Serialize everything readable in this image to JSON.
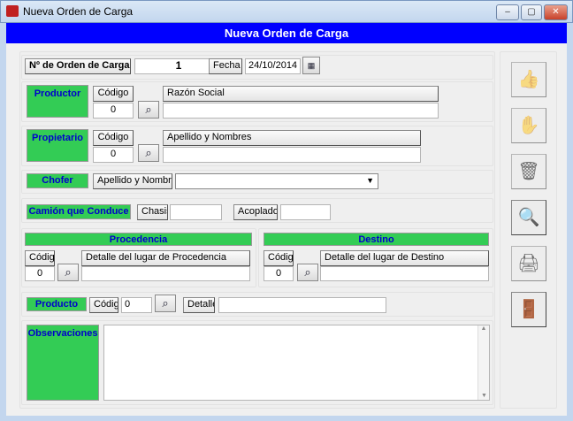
{
  "window": {
    "title": "Nueva Orden de Carga",
    "minimize": "‒",
    "maximize": "▢",
    "close": "✕"
  },
  "header": "Nueva Orden de Carga",
  "orden": {
    "label": "Nº de Orden de Carga",
    "value": "1",
    "fecha_label": "Fecha",
    "fecha_value": "24/10/2014"
  },
  "productor": {
    "label": "Productor",
    "codigo_label": "Código",
    "codigo_value": "0",
    "razon_label": "Razón Social",
    "razon_value": ""
  },
  "propietario": {
    "label": "Propietario",
    "codigo_label": "Código",
    "codigo_value": "0",
    "nombre_label": "Apellido y Nombres",
    "nombre_value": ""
  },
  "chofer": {
    "label": "Chofer",
    "nombre_label": "Apellido y Nombres",
    "select_value": ""
  },
  "camion": {
    "label": "Camión que Conduce",
    "chasis_label": "Chasis",
    "chasis_value": "",
    "acoplado_label": "Acoplado",
    "acoplado_value": ""
  },
  "procedencia": {
    "label": "Procedencia",
    "codigo_label": "Código",
    "codigo_value": "0",
    "detalle_label": "Detalle del lugar de Procedencia",
    "detalle_value": ""
  },
  "destino": {
    "label": "Destino",
    "codigo_label": "Código",
    "codigo_value": "0",
    "detalle_label": "Detalle del lugar de Destino",
    "detalle_value": ""
  },
  "producto": {
    "label": "Producto",
    "codigo_label": "Código",
    "codigo_value": "0",
    "detalle_label": "Detalle",
    "detalle_value": ""
  },
  "observaciones": {
    "label": "Observaciones",
    "value": ""
  },
  "toolbar": [
    {
      "icon": "accept-icon",
      "glyph": "👍"
    },
    {
      "icon": "cancel-icon",
      "glyph": "✋"
    },
    {
      "icon": "trash-icon",
      "glyph": "🗑"
    },
    {
      "icon": "search-document-icon",
      "glyph": "🔍"
    },
    {
      "icon": "printer-icon",
      "glyph": "🖨"
    },
    {
      "icon": "exit-door-icon",
      "glyph": "🚪"
    }
  ]
}
